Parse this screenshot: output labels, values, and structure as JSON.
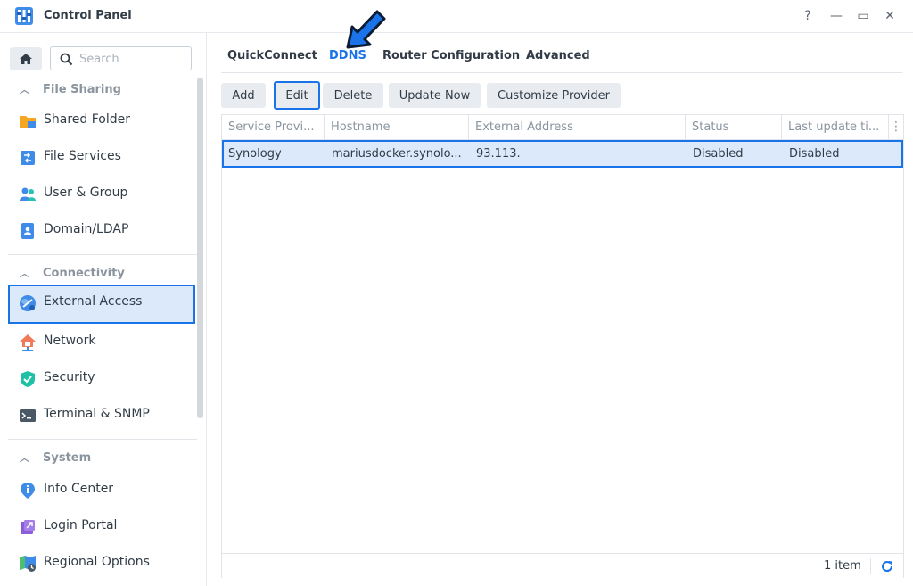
{
  "window": {
    "title": "Control Panel",
    "help_glyph": "?",
    "minimize_glyph": "—",
    "maximize_glyph": "▭",
    "close_glyph": "✕"
  },
  "sidebar": {
    "search_placeholder": "Search",
    "sections": [
      {
        "title": "File Sharing",
        "items": [
          "Shared Folder",
          "File Services",
          "User & Group",
          "Domain/LDAP"
        ]
      },
      {
        "title": "Connectivity",
        "items": [
          "External Access",
          "Network",
          "Security",
          "Terminal & SNMP"
        ]
      },
      {
        "title": "System",
        "items": [
          "Info Center",
          "Login Portal",
          "Regional Options"
        ]
      }
    ],
    "active_item": "External Access"
  },
  "tabs": [
    "QuickConnect",
    "DDNS",
    "Router Configuration",
    "Advanced"
  ],
  "active_tab": "DDNS",
  "toolbar": {
    "add": "Add",
    "edit": "Edit",
    "delete": "Delete",
    "update_now": "Update Now",
    "customize_provider": "Customize Provider"
  },
  "table": {
    "columns": [
      "Service Provi...",
      "Hostname",
      "External Address",
      "Status",
      "Last update ti..."
    ],
    "rows": [
      [
        "Synology",
        "mariusdocker.synolo...",
        "93.113.",
        "Disabled",
        "Disabled"
      ]
    ],
    "footer_count": "1 item"
  },
  "colors": {
    "accent": "#1a73e8",
    "selection": "#dbe9fa",
    "button_bg": "#e8ecf0"
  }
}
